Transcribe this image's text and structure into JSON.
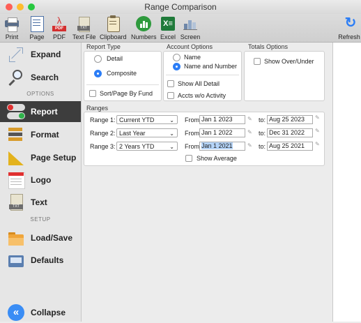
{
  "window": {
    "title": "Range Comparison"
  },
  "toolbar": {
    "print": "Print",
    "page": "Page",
    "pdf": "PDF",
    "text_file": "Text File",
    "clipboard": "Clipboard",
    "numbers": "Numbers",
    "excel": "Excel",
    "screen": "Screen",
    "refresh": "Refresh"
  },
  "sidebar": {
    "expand": "Expand",
    "search": "Search",
    "options_header": "OPTIONS",
    "report": "Report",
    "format": "Format",
    "page_setup": "Page Setup",
    "logo": "Logo",
    "text": "Text",
    "setup_header": "SETUP",
    "load_save": "Load/Save",
    "defaults": "Defaults",
    "collapse": "Collapse"
  },
  "report_type": {
    "label": "Report Type",
    "detail": "Detail",
    "composite": "Composite",
    "selected": "Composite",
    "sort_by_fund": "Sort/Page By Fund"
  },
  "account_options": {
    "label": "Account Options",
    "name": "Name",
    "name_and_number": "Name and Number",
    "selected": "Name and Number",
    "show_all_detail": "Show All Detail",
    "accts_wo_activity": "Accts w/o Activity"
  },
  "totals_options": {
    "label": "Totals Options",
    "show_over_under": "Show Over/Under"
  },
  "ranges": {
    "label": "Ranges",
    "from_label": "From:",
    "to_label": "to:",
    "rows": [
      {
        "label": "Range 1:",
        "period": "Current YTD",
        "from": "Jan 1 2023",
        "to": "Aug 25 2023"
      },
      {
        "label": "Range 2:",
        "period": "Last Year",
        "from": "Jan 1 2022",
        "to": "Dec 31 2022"
      },
      {
        "label": "Range 3:",
        "period": "2 Years YTD",
        "from": "Jan 1 2021",
        "to": "Aug 25 2021"
      }
    ],
    "show_average": "Show Average"
  },
  "colors": {
    "accent": "#2b7df6",
    "active_sidebar": "#3d3d3d",
    "numbers_green": "#2e9a3d",
    "excel_green": "#1f7a3a"
  }
}
